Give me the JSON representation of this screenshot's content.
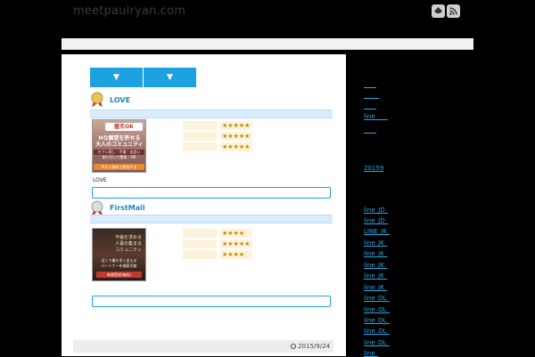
{
  "site_title": "meetpaulryan.com",
  "header_icons": [
    "feedly-icon",
    "rss-icon"
  ],
  "tabs": [
    "▼",
    "▼"
  ],
  "rankings": [
    {
      "title": "LOVE",
      "banner_text": [
        "匿名OK",
        "Hな願望を許せる",
        "大人のコミュニティ",
        "セフレ探し・不倫・出会い",
        "割り切って関係・SM",
        "今すぐ無料で参加する"
      ],
      "stars": [
        "★★★★★",
        "★★★★★",
        "★★★★★"
      ],
      "description": "LOVE"
    },
    {
      "title": "FirstMail",
      "banner_text": [
        "不倫を求める",
        "人妻の集まる",
        "コミュニティ",
        "近くで最も早く会える",
        "パートナーを検索可能",
        "新規登録(無料)"
      ],
      "stars": [
        "★★★★",
        "★★★★★",
        "★★★★"
      ],
      "description": ""
    }
  ],
  "post_date": "2015/9/24",
  "sidebar": {
    "links_top": [
      "____",
      "_____",
      "____",
      "line____",
      "____"
    ],
    "year_link": "20159",
    "links_bottom": [
      "line_JD_",
      "line_JD_",
      "LINE_JK_",
      "line_JK_",
      "line_JK_",
      "line_JK_",
      "line_JK_",
      "line_JK_",
      "line_OL_",
      "line_OL_",
      "line_OL_",
      "line_OL_",
      "line_OL_",
      "line_"
    ]
  },
  "colors": {
    "accent": "#1ea1e0",
    "background": "#000000",
    "content": "#ffffff"
  }
}
